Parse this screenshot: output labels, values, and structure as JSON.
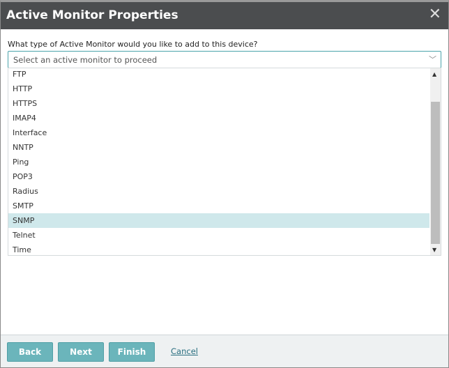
{
  "dialog": {
    "title": "Active Monitor Properties",
    "close_icon": "close-icon"
  },
  "question": "What type of Active Monitor would you like to add to this device?",
  "select": {
    "placeholder": "Select an active monitor to proceed"
  },
  "list": {
    "items": [
      "FTP",
      "HTTP",
      "HTTPS",
      "IMAP4",
      "Interface",
      "NNTP",
      "Ping",
      "POP3",
      "Radius",
      "SMTP",
      "SNMP",
      "Telnet",
      "Time"
    ],
    "highlighted": "SNMP"
  },
  "footer": {
    "back": "Back",
    "next": "Next",
    "finish": "Finish",
    "cancel": "Cancel"
  },
  "colors": {
    "accent": "#6bb5bb",
    "highlight": "#cfe8eb",
    "titlebar": "#4b4d4f"
  }
}
